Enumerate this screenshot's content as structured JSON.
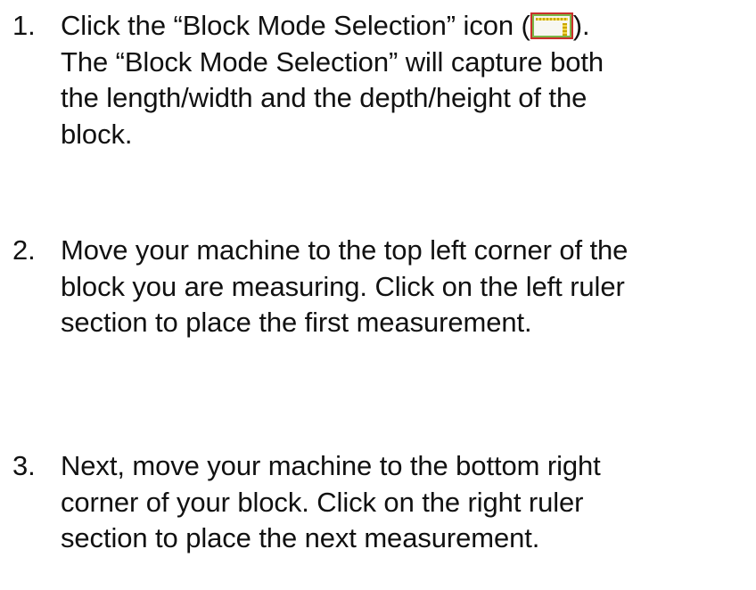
{
  "steps": [
    {
      "number": "1.",
      "lines": [
        "Click the “Block Mode Selection” icon (",
        ").",
        "The “Block Mode Selection” will capture both",
        "the length/width and the depth/height of the",
        "block."
      ],
      "icon": "block-mode-selection-icon"
    },
    {
      "number": "2.",
      "lines": [
        "Move your machine to the top left corner of the",
        "block you are measuring. Click on the left ruler",
        "section to place the first measurement."
      ]
    },
    {
      "number": "3.",
      "lines": [
        "Next, move your machine to the bottom right",
        "corner of your block. Click on the right ruler",
        "section to place the next measurement."
      ]
    }
  ],
  "colors": {
    "icon_border": "#c9302c",
    "icon_inner_border": "#7ab648",
    "icon_ruler": "#f2d84a"
  }
}
